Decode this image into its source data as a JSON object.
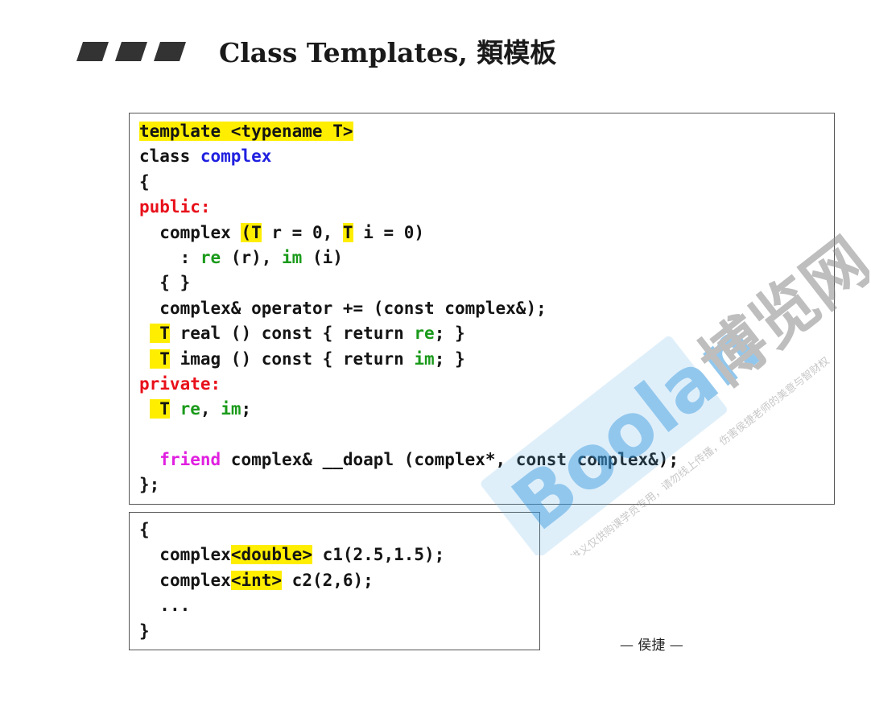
{
  "slide": {
    "title": "Class Templates, 類模板",
    "signature": "— 侯捷 —",
    "accent_color": "#ffee00"
  },
  "code_block_1": {
    "lines": [
      {
        "indent": "",
        "tokens": [
          {
            "text": "template <typename T>",
            "hl": true
          }
        ]
      },
      {
        "indent": "",
        "tokens": [
          {
            "text": "class "
          },
          {
            "text": "complex",
            "color": "blue"
          }
        ]
      },
      {
        "indent": "",
        "tokens": [
          {
            "text": "{"
          }
        ]
      },
      {
        "indent": "",
        "tokens": [
          {
            "text": "public:",
            "color": "red"
          }
        ]
      },
      {
        "indent": "  ",
        "tokens": [
          {
            "text": "complex "
          },
          {
            "text": "(T",
            "hl": true
          },
          {
            "text": " r = 0, "
          },
          {
            "text": "T",
            "hl": true
          },
          {
            "text": " i = 0)"
          }
        ]
      },
      {
        "indent": "    ",
        "tokens": [
          {
            "text": ": "
          },
          {
            "text": "re",
            "color": "green"
          },
          {
            "text": " (r), "
          },
          {
            "text": "im",
            "color": "green"
          },
          {
            "text": " (i)"
          }
        ]
      },
      {
        "indent": "  ",
        "tokens": [
          {
            "text": "{ }"
          }
        ]
      },
      {
        "indent": "  ",
        "tokens": [
          {
            "text": "complex& operator += (const complex&);"
          }
        ]
      },
      {
        "indent": " ",
        "tokens": [
          {
            "text": " T",
            "hl": true
          },
          {
            "text": " real () const { return "
          },
          {
            "text": "re",
            "color": "green"
          },
          {
            "text": "; }"
          }
        ]
      },
      {
        "indent": " ",
        "tokens": [
          {
            "text": " T",
            "hl": true
          },
          {
            "text": " imag () const { return "
          },
          {
            "text": "im",
            "color": "green"
          },
          {
            "text": "; }"
          }
        ]
      },
      {
        "indent": "",
        "tokens": [
          {
            "text": "private:",
            "color": "red"
          }
        ]
      },
      {
        "indent": " ",
        "tokens": [
          {
            "text": " T",
            "hl": true
          },
          {
            "text": " "
          },
          {
            "text": "re",
            "color": "green"
          },
          {
            "text": ", "
          },
          {
            "text": "im",
            "color": "green"
          },
          {
            "text": ";"
          }
        ]
      },
      {
        "indent": "",
        "tokens": []
      },
      {
        "indent": "  ",
        "tokens": [
          {
            "text": "friend",
            "color": "magenta"
          },
          {
            "text": " complex& __doapl (complex*, const complex&);"
          }
        ]
      },
      {
        "indent": "",
        "tokens": [
          {
            "text": "};"
          }
        ]
      }
    ]
  },
  "code_block_2": {
    "lines": [
      {
        "indent": "",
        "tokens": [
          {
            "text": "{"
          }
        ]
      },
      {
        "indent": "  ",
        "tokens": [
          {
            "text": "complex"
          },
          {
            "text": "<double>",
            "hl": true
          },
          {
            "text": " c1(2.5,1.5);"
          }
        ]
      },
      {
        "indent": "  ",
        "tokens": [
          {
            "text": "complex"
          },
          {
            "text": "<int>",
            "hl": true
          },
          {
            "text": " c2(2,6);"
          }
        ]
      },
      {
        "indent": "  ",
        "tokens": [
          {
            "text": "..."
          }
        ]
      },
      {
        "indent": "",
        "tokens": [
          {
            "text": "}"
          }
        ]
      }
    ]
  },
  "watermark": {
    "brand_text": "Boolan",
    "cn_text": "博览网",
    "notice_text": "本讲义仅供购课学员专用，请勿线上传播，伤害侯捷老师的美意与智财权",
    "brand_color": "#3a9be0"
  }
}
